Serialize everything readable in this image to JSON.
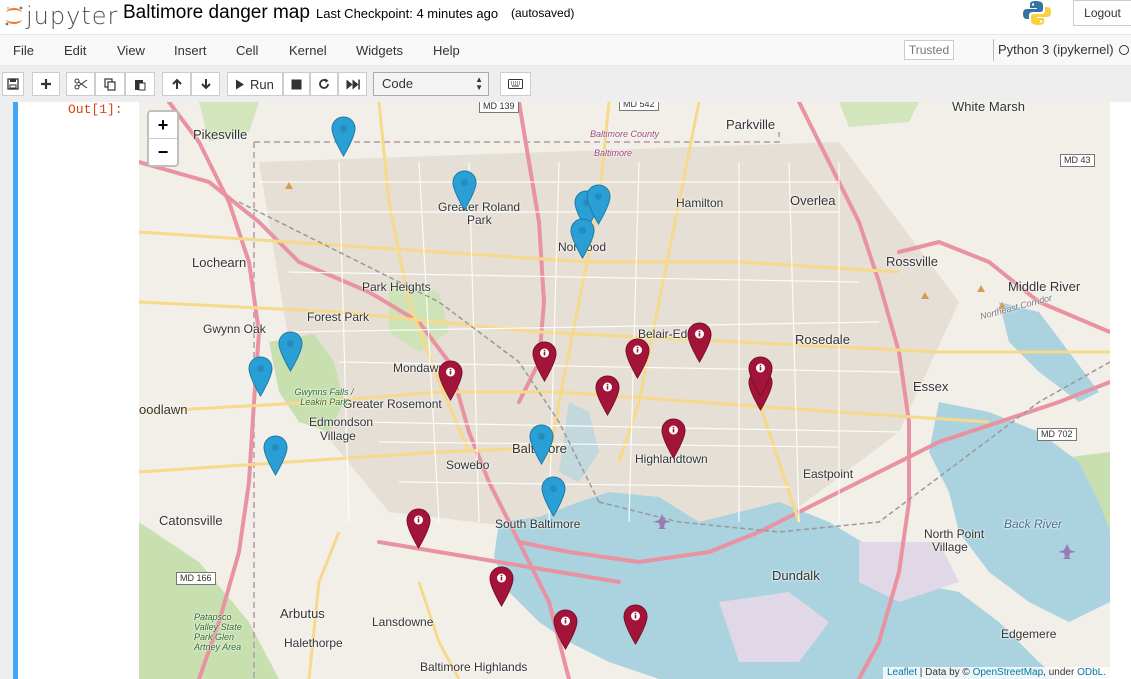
{
  "header": {
    "logo_text": "jupyter",
    "notebook_title": "Baltimore danger map",
    "checkpoint": "Last Checkpoint: 4 minutes ago",
    "autosave_status": "(autosaved)",
    "logout_label": "Logout"
  },
  "menubar": {
    "items": [
      "File",
      "Edit",
      "View",
      "Insert",
      "Cell",
      "Kernel",
      "Widgets",
      "Help"
    ],
    "trusted_label": "Trusted",
    "kernel_name": "Python 3 (ipykernel)"
  },
  "toolbar": {
    "run_label": "Run",
    "cell_type": "Code",
    "icons": [
      "save-icon",
      "plus-icon",
      "cut-icon",
      "copy-icon",
      "paste-icon",
      "arrow-up-icon",
      "arrow-down-icon",
      "run-icon",
      "stop-icon",
      "restart-icon",
      "fast-forward-icon",
      "keyboard-icon"
    ]
  },
  "cell": {
    "out_prompt": "Out[1]:"
  },
  "map": {
    "zoom_in": "+",
    "zoom_out": "−",
    "place_labels": [
      "Pikesville",
      "Parkville",
      "White Marsh",
      "Overlea",
      "Hamilton",
      "Greater Roland",
      "Park",
      "Norwood",
      "Lochearn",
      "Park Heights",
      "Forest Park",
      "Gwynn Oak",
      "Mondawmin",
      "Greater Rosemont",
      "Edmondson",
      "Village",
      "Woodlawn",
      "Belair-Edison",
      "Rosedale",
      "Rossville",
      "Middle River",
      "Essex",
      "Baltimore",
      "Highlandtown",
      "Sowebo",
      "Eastpoint",
      "South Baltimore",
      "Catonsville",
      "North Point",
      "Village",
      "Back River",
      "Dundalk",
      "Arbutus",
      "Lansdowne",
      "Halethorpe",
      "Edgemere",
      "Baltimore Highlands",
      "Baltimore County",
      "Baltimore"
    ],
    "road_shields": [
      "MD 139",
      "MD 542",
      "MD 43",
      "MD 702",
      "MD 166"
    ],
    "park_labels": [
      "Gwynns Falls / Leakin Park",
      "Patapsco Valley State Park Glen Artney Area",
      "Northeast Corridor"
    ],
    "blue_markers_count": 9,
    "red_markers_count": 12,
    "marker_colors": {
      "blue": "#2a9fd6",
      "red": "#a3143a"
    },
    "attribution": {
      "leaflet": "Leaflet",
      "separator": " | Data by © ",
      "osm": "OpenStreetMap",
      "under": ", under ",
      "license": "ODbL."
    }
  }
}
